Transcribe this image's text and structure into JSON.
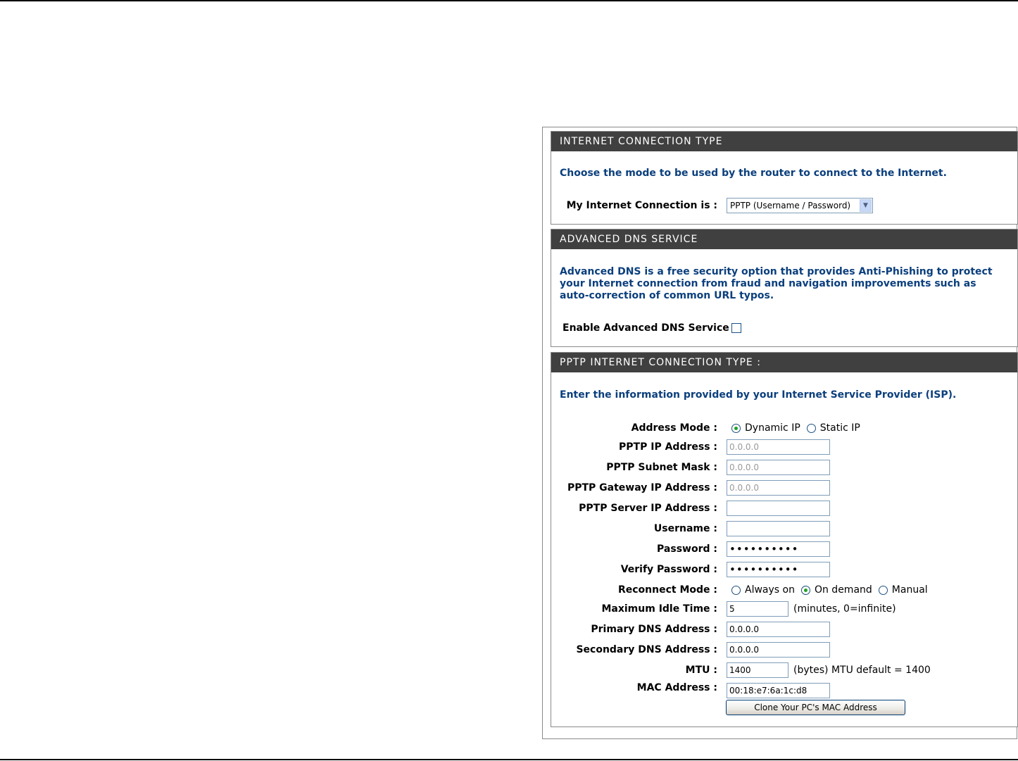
{
  "connection_type": {
    "header": "INTERNET CONNECTION TYPE",
    "description": "Choose the mode to be used by the router to connect to the Internet.",
    "label": "My Internet Connection is :",
    "selected": "PPTP (Username / Password)"
  },
  "advanced_dns": {
    "header": "ADVANCED DNS SERVICE",
    "description": "Advanced DNS is a free security option that provides Anti-Phishing to protect your Internet connection from fraud and navigation improvements such as auto-correction of common URL typos.",
    "enable_label": "Enable Advanced DNS Service :",
    "enabled": false
  },
  "pptp": {
    "header": "PPTP INTERNET CONNECTION TYPE :",
    "description": "Enter the information provided by your Internet Service Provider (ISP).",
    "address_mode": {
      "label": "Address Mode :",
      "options": [
        "Dynamic IP",
        "Static IP"
      ],
      "selected": "Dynamic IP"
    },
    "ip_address": {
      "label": "PPTP IP Address :",
      "value": "0.0.0.0"
    },
    "subnet_mask": {
      "label": "PPTP Subnet Mask :",
      "value": "0.0.0.0"
    },
    "gateway": {
      "label": "PPTP Gateway IP Address :",
      "value": "0.0.0.0"
    },
    "server_ip": {
      "label": "PPTP Server IP Address :",
      "value": ""
    },
    "username": {
      "label": "Username :",
      "value": ""
    },
    "password": {
      "label": "Password :",
      "value": "••••••••••"
    },
    "verify_password": {
      "label": "Verify Password :",
      "value": "••••••••••"
    },
    "reconnect_mode": {
      "label": "Reconnect Mode :",
      "options": [
        "Always on",
        "On demand",
        "Manual"
      ],
      "selected": "On demand"
    },
    "max_idle": {
      "label": "Maximum Idle Time :",
      "value": "5",
      "note": "(minutes, 0=infinite)"
    },
    "primary_dns": {
      "label": "Primary DNS Address :",
      "value": "0.0.0.0"
    },
    "secondary_dns": {
      "label": "Secondary DNS Address :",
      "value": "0.0.0.0"
    },
    "mtu": {
      "label": "MTU :",
      "value": "1400",
      "note": "(bytes) MTU default = 1400"
    },
    "mac": {
      "label": "MAC Address :",
      "value": "00:18:e7:6a:1c:d8"
    },
    "clone_button": "Clone Your PC's MAC Address"
  },
  "colors": {
    "header_bg": "#404040",
    "description_text": "#0b3f7d",
    "radio_dot": "#21a121"
  }
}
